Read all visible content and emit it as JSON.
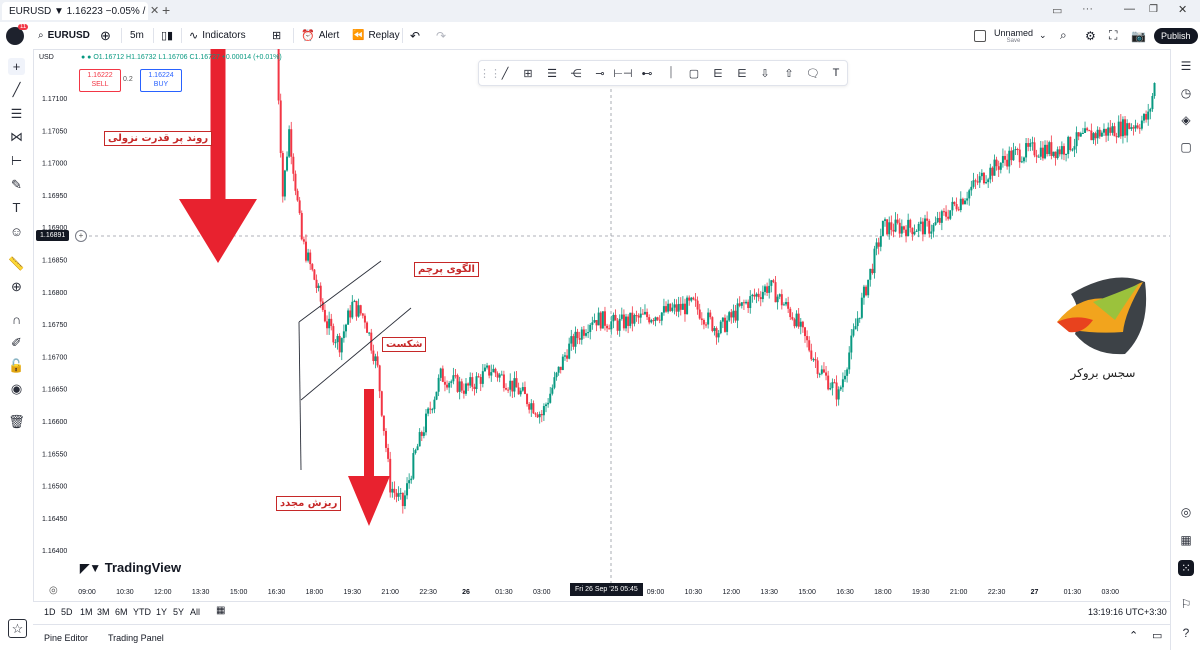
{
  "tab": {
    "title": "EURUSD ▼ 1.16223 −0.05% / Un",
    "new_tab": "+",
    "badge": "11"
  },
  "toolbar": {
    "symbol": "EURUSD",
    "interval": "5m",
    "indicators": "Indicators",
    "alert": "Alert",
    "replay": "Replay",
    "layout_name": "Unnamed",
    "layout_sub": "Save",
    "publish": "Publish"
  },
  "legend": {
    "currency": "USD",
    "ohlc": "O1.16712 H1.16732 L1.16706 C1.16727 +0.00014 (+0.01%)",
    "sell_price": "1.16222",
    "sell_label": "SELL",
    "spread": "0.2",
    "buy_price": "1.16224",
    "buy_label": "BUY"
  },
  "crosshair_price": "1.16891",
  "watermark": "TradingView",
  "brand_text": "سجس بروکر",
  "annotations": {
    "strong_downtrend": "روند پر قدرت نزولی",
    "flag_pattern": "الگوی پرچم",
    "breakout": "شکست",
    "continued_drop": "ریزش مجدد"
  },
  "time_focus_label": "Fri 26 Sep '25   05:45",
  "bottom": {
    "ranges": [
      "1D",
      "5D",
      "1M",
      "3M",
      "6M",
      "YTD",
      "1Y",
      "5Y",
      "All"
    ],
    "clock": "13:19:16 UTC+3:30"
  },
  "footer": {
    "pine_editor": "Pine Editor",
    "trading_panel": "Trading Panel"
  },
  "colors": {
    "up": "#089981",
    "down": "#f23645",
    "arrow": "#e8222f",
    "accent": "#2962ff"
  },
  "chart_data": {
    "type": "candlestick",
    "symbol": "EURUSD",
    "interval": "5m",
    "y_ticks": [
      "1.17100",
      "1.17050",
      "1.17000",
      "1.16950",
      "1.16900",
      "1.16850",
      "1.16800",
      "1.16750",
      "1.16700",
      "1.16650",
      "1.16600",
      "1.16550",
      "1.16500",
      "1.16450",
      "1.16400"
    ],
    "x_ticks": [
      "09:00",
      "10:30",
      "12:00",
      "13:30",
      "15:00",
      "16:30",
      "18:00",
      "19:30",
      "21:00",
      "22:30",
      "26",
      "01:30",
      "03:00",
      "04:30",
      "06:00",
      "09:00",
      "10:30",
      "12:00",
      "13:30",
      "15:00",
      "16:30",
      "18:00",
      "19:30",
      "21:00",
      "22:30",
      "27",
      "01:30",
      "03:00"
    ],
    "price_path": [
      {
        "t": "16:30",
        "price": 1.1718
      },
      {
        "t": "16:45",
        "price": 1.1695
      },
      {
        "t": "17:00",
        "price": 1.1705
      },
      {
        "t": "17:30",
        "price": 1.1688
      },
      {
        "t": "18:00",
        "price": 1.1682
      },
      {
        "t": "18:30",
        "price": 1.1675
      },
      {
        "t": "19:00",
        "price": 1.1672
      },
      {
        "t": "19:30",
        "price": 1.1678
      },
      {
        "t": "20:00",
        "price": 1.1676
      },
      {
        "t": "20:30",
        "price": 1.1668
      },
      {
        "t": "21:00",
        "price": 1.165
      },
      {
        "t": "21:30",
        "price": 1.1647
      },
      {
        "t": "22:00",
        "price": 1.1655
      },
      {
        "t": "23:00",
        "price": 1.1667
      },
      {
        "t": "00:00",
        "price": 1.1665
      },
      {
        "t": "01:00",
        "price": 1.1668
      },
      {
        "t": "02:00",
        "price": 1.1665
      },
      {
        "t": "03:00",
        "price": 1.1661
      },
      {
        "t": "04:00",
        "price": 1.1671
      },
      {
        "t": "05:00",
        "price": 1.1676
      },
      {
        "t": "06:00",
        "price": 1.1675
      },
      {
        "t": "07:00",
        "price": 1.1676
      },
      {
        "t": "08:00",
        "price": 1.1677
      },
      {
        "t": "09:00",
        "price": 1.1678
      },
      {
        "t": "10:00",
        "price": 1.1674
      },
      {
        "t": "11:00",
        "price": 1.1678
      },
      {
        "t": "12:00",
        "price": 1.1681
      },
      {
        "t": "13:00",
        "price": 1.1676
      },
      {
        "t": "14:00",
        "price": 1.1668
      },
      {
        "t": "14:45",
        "price": 1.1664
      },
      {
        "t": "15:30",
        "price": 1.1676
      },
      {
        "t": "16:30",
        "price": 1.169
      },
      {
        "t": "17:30",
        "price": 1.169
      },
      {
        "t": "18:30",
        "price": 1.169
      },
      {
        "t": "19:30",
        "price": 1.1694
      },
      {
        "t": "20:30",
        "price": 1.1698
      },
      {
        "t": "21:30",
        "price": 1.1701
      },
      {
        "t": "22:30",
        "price": 1.1702
      },
      {
        "t": "23:30",
        "price": 1.1702
      },
      {
        "t": "00:30",
        "price": 1.1704
      },
      {
        "t": "01:30",
        "price": 1.1705
      },
      {
        "t": "02:30",
        "price": 1.1706
      },
      {
        "t": "03:00",
        "price": 1.1707
      },
      {
        "t": "03:15",
        "price": 1.1712
      }
    ],
    "last_price": 1.16727,
    "ylim": [
      1.164,
      1.172
    ]
  }
}
